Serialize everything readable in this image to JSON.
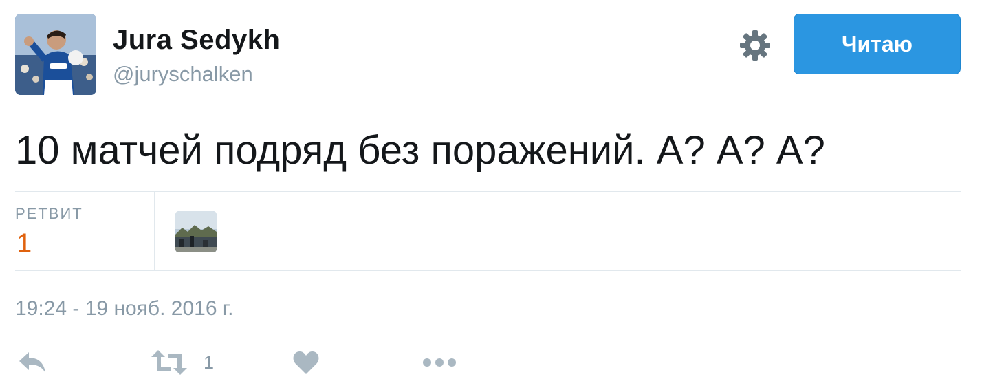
{
  "user": {
    "display_name": "Jura Sedykh",
    "handle": "@juryschalken"
  },
  "header": {
    "settings_icon": "gear-icon",
    "follow_label": "Читаю"
  },
  "tweet": {
    "text": "10 матчей подряд без поражений. А? А? А?",
    "timestamp": "19:24 - 19 нояб. 2016 г."
  },
  "stats": {
    "retweets_label": "РЕТВИТ",
    "retweets_count": "1"
  },
  "actions": {
    "reply_icon": "reply-icon",
    "retweet_icon": "retweet-icon",
    "retweet_count": "1",
    "like_icon": "heart-icon",
    "more_icon": "more-dots-icon"
  },
  "colors": {
    "accent": "#2b96e1",
    "stat_value": "#e0620e",
    "muted": "#8899a6",
    "divider": "#e1e8ed"
  }
}
